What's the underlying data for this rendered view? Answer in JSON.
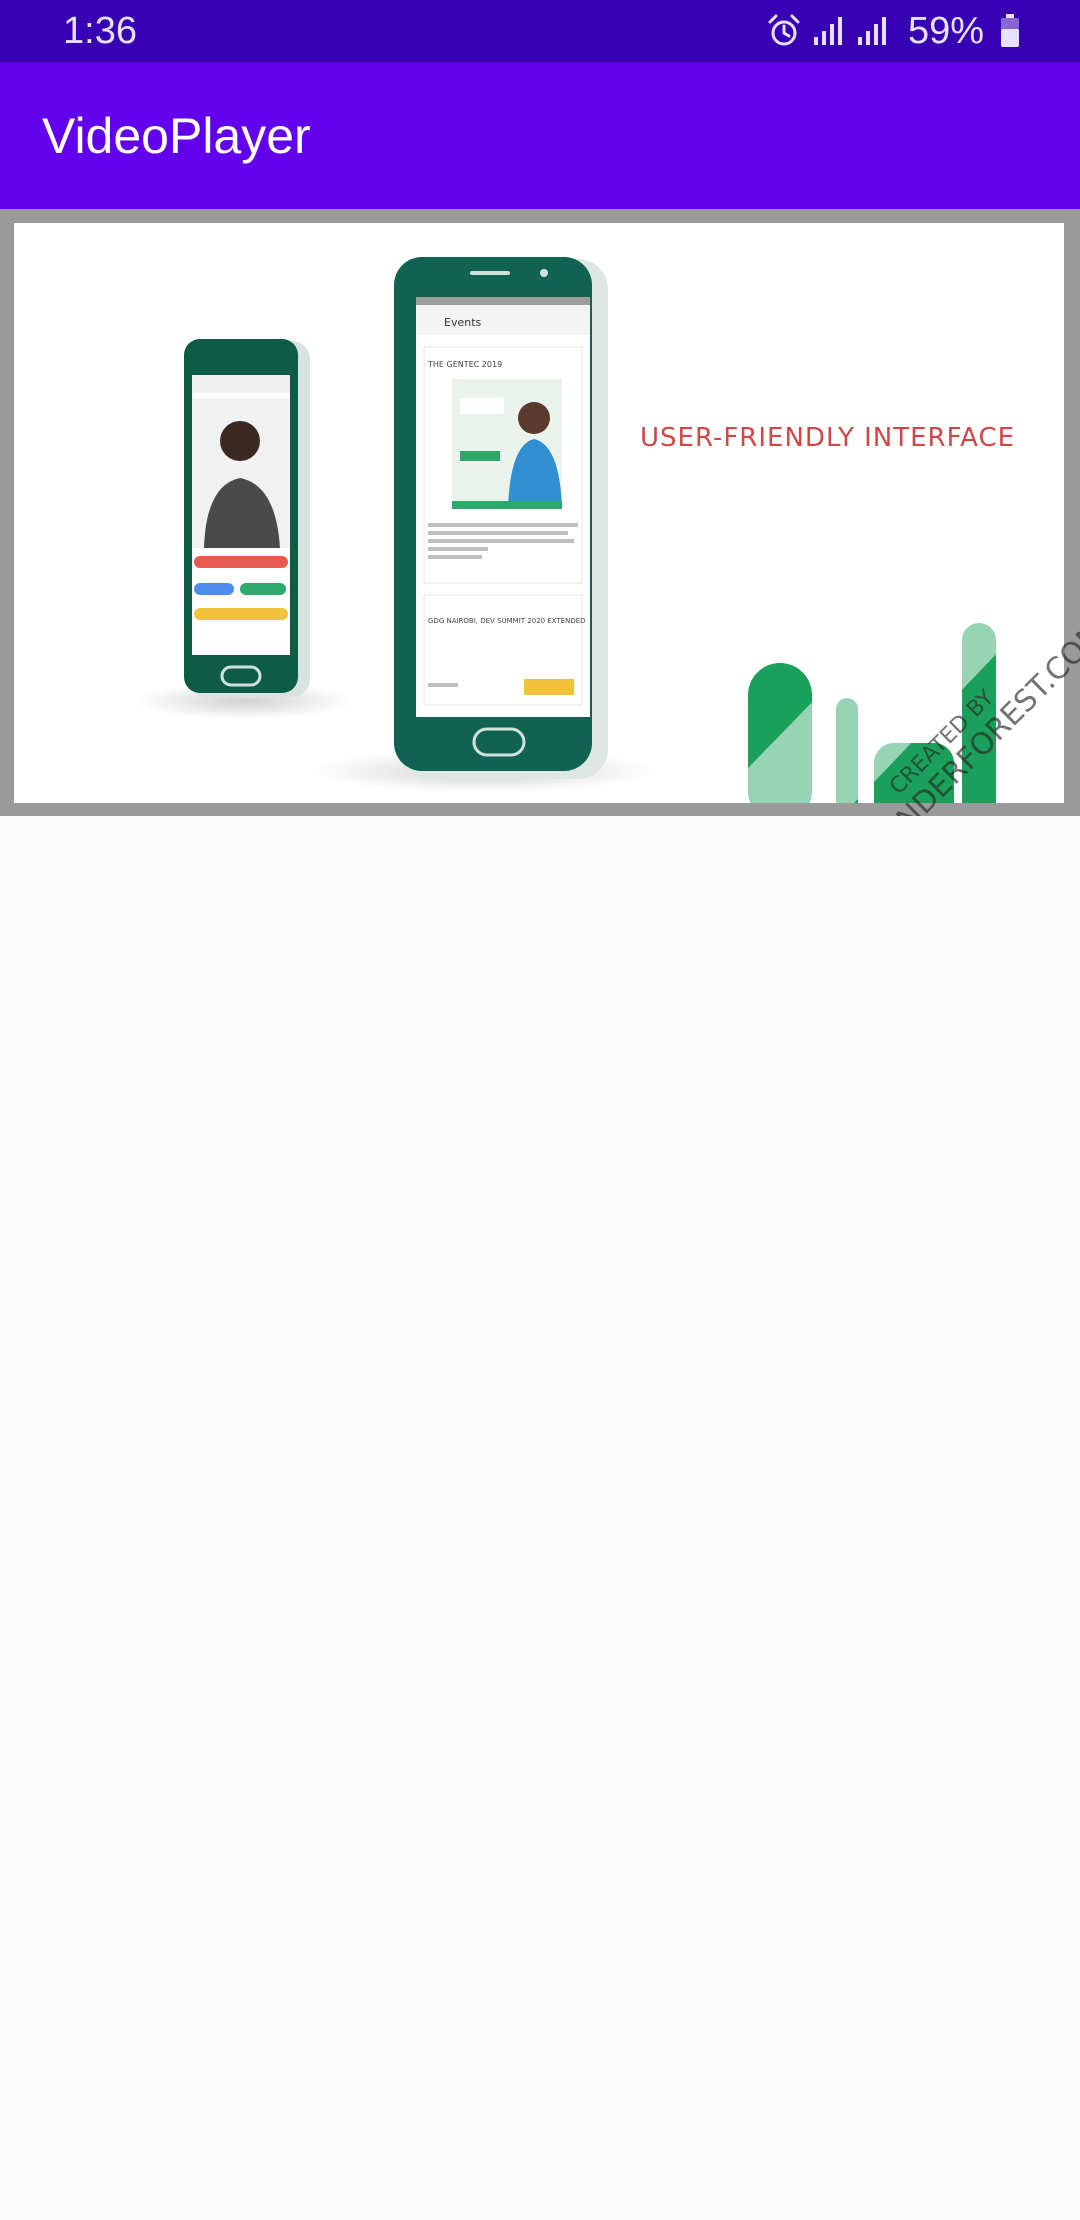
{
  "status_bar": {
    "time": "1:36",
    "battery_percent": "59%",
    "icons": [
      "alarm-icon",
      "signal-icon",
      "signal-icon",
      "battery-icon"
    ]
  },
  "app_bar": {
    "title": "VideoPlayer"
  },
  "video": {
    "headline": "USER-FRIENDLY INTERFACE",
    "watermark_line1": "CREATED BY",
    "watermark_line2": "RENDERFOREST.COM",
    "phone_screen_title": "Events",
    "phone_event_1": "THE GENTEC 2019",
    "phone_event_2": "GDG NAIROBI, DEV SUMMIT 2020 EXTENDED"
  },
  "colors": {
    "status_bar": "#3700b3",
    "app_bar": "#6200ee",
    "background": "#fafafa",
    "phone_green": "#0e5c46",
    "chart_green": "#1aa05a",
    "headline_red": "#cf4747"
  }
}
